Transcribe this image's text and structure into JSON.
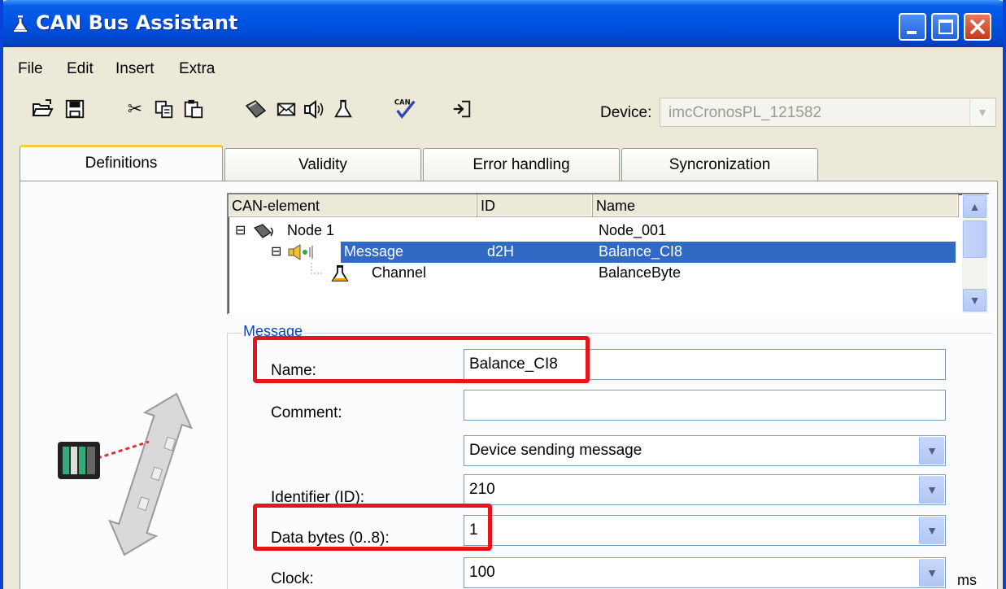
{
  "window": {
    "title": "CAN Bus Assistant",
    "title_icon": "flask-icon",
    "controls": [
      "minimize",
      "maximize",
      "close"
    ]
  },
  "menu": {
    "items": [
      "File",
      "Edit",
      "Insert",
      "Extra"
    ]
  },
  "toolbar": {
    "tools": [
      "open-folder-icon",
      "save-icon",
      "cut-icon",
      "copy-icon",
      "paste-icon",
      "node-icon",
      "message-icon",
      "speaker-icon",
      "channel-flask-icon",
      "can-check-icon",
      "import-icon"
    ],
    "can_check_text": "CAN",
    "device_label": "Device:",
    "device_value": "imcCronosPL_121582"
  },
  "tabs": [
    "Definitions",
    "Validity",
    "Error handling",
    "Syncronization"
  ],
  "active_tab": "Definitions",
  "tree": {
    "columns": [
      "CAN-element",
      "ID",
      "Name"
    ],
    "rows": [
      {
        "element": "Node 1",
        "id": "",
        "name": "Node_001",
        "level": 0,
        "expander": "⊟"
      },
      {
        "element": "Message",
        "id": "d2H",
        "name": "Balance_CI8",
        "level": 1,
        "expander": "⊟",
        "selected": true
      },
      {
        "element": "Channel",
        "id": "",
        "name": "BalanceByte",
        "level": 2,
        "expander": ""
      }
    ]
  },
  "message_group": {
    "legend": "Message",
    "name_label": "Name:",
    "name_value": "Balance_CI8",
    "comment_label": "Comment:",
    "comment_value": "",
    "direction_value": "Device sending message",
    "identifier_label": "Identifier (ID):",
    "identifier_value": "210",
    "databytes_label": "Data bytes (0..8):",
    "databytes_value": "1",
    "clock_label": "Clock:",
    "clock_value": "100",
    "clock_unit": "ms"
  },
  "colors": {
    "titlebar": "#0054e3",
    "selection": "#316ac5",
    "highlight_box": "#e8141b",
    "group_legend": "#0046d5"
  }
}
